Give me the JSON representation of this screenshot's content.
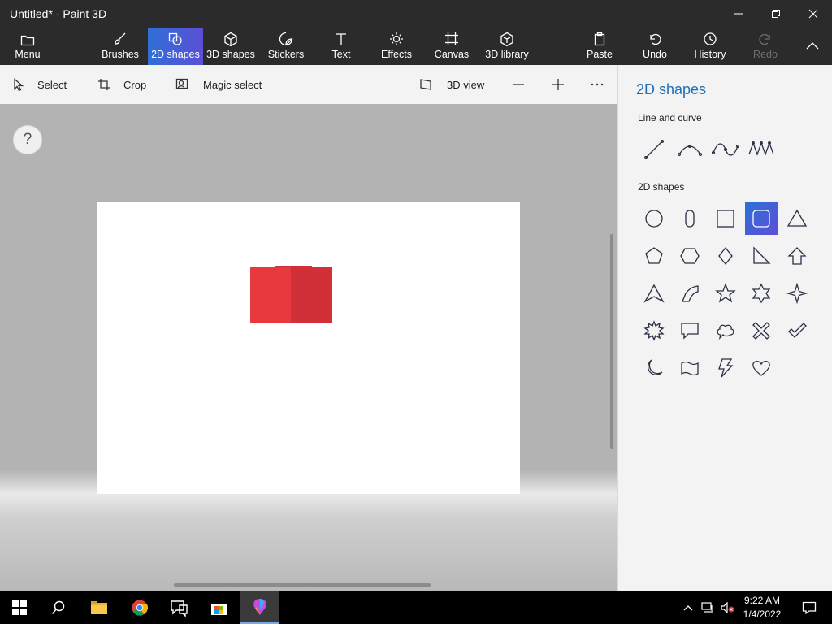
{
  "window": {
    "title": "Untitled* - Paint 3D"
  },
  "ribbon": {
    "menu": "Menu",
    "brushes": "Brushes",
    "shapes2d": "2D shapes",
    "shapes3d": "3D shapes",
    "stickers": "Stickers",
    "text": "Text",
    "effects": "Effects",
    "canvas": "Canvas",
    "library3d": "3D library",
    "paste": "Paste",
    "undo": "Undo",
    "history": "History",
    "redo": "Redo"
  },
  "toolbar": {
    "select": "Select",
    "crop": "Crop",
    "magic_select": "Magic select",
    "view3d": "3D view"
  },
  "canvas": {
    "help": "?"
  },
  "panel": {
    "title": "2D shapes",
    "line_section": "Line and curve",
    "shapes_section": "2D shapes",
    "selected_shape": "rounded-square"
  },
  "taskbar": {
    "time": "9:22 AM",
    "date": "1/4/2022"
  },
  "colors": {
    "accent": "#2f6fd6",
    "accent_end": "#5b4fd6",
    "shape_red_light": "#e8393f",
    "shape_red_dark": "#d23038"
  }
}
